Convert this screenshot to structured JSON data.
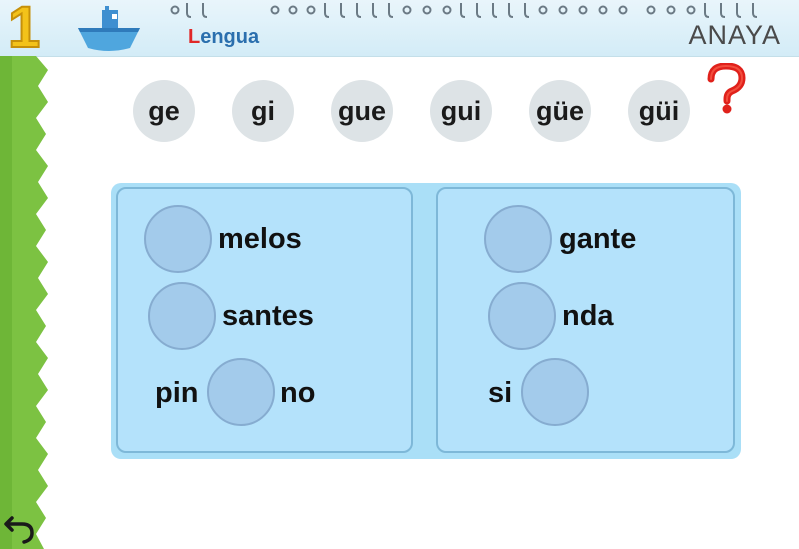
{
  "header": {
    "unit_number": "1",
    "subject_first": "L",
    "subject_rest": "engua",
    "logo": "ANAYA"
  },
  "syllables": [
    "ge",
    "gi",
    "gue",
    "gui",
    "güe",
    "güi"
  ],
  "help_icon": "question-mark-icon",
  "left_panel": {
    "rows": [
      {
        "before": "",
        "after": "melos"
      },
      {
        "before": "",
        "after": "santes"
      },
      {
        "before": "pin",
        "after": "no"
      }
    ]
  },
  "right_panel": {
    "rows": [
      {
        "before": "",
        "after": "gante"
      },
      {
        "before": "",
        "after": "nda"
      },
      {
        "before": "si",
        "after": ""
      }
    ]
  },
  "colors": {
    "accent_green": "#7cc242",
    "slot_blue": "#a3cbeb",
    "panel_blue": "#b4e2fb",
    "help_red": "#e0211b"
  }
}
